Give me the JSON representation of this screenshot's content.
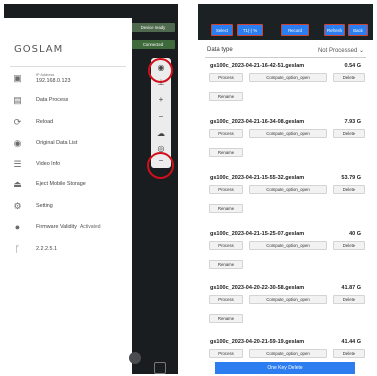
{
  "left_panel": {
    "brand": "GOSLAM",
    "status": {
      "ready": "Device ready",
      "connected": "Connected"
    },
    "menu": [
      {
        "icon": "device-icon",
        "sublabel": "IP Address",
        "value": "192.168.0.123"
      },
      {
        "icon": "clipboard-icon",
        "label": "Data Process"
      },
      {
        "icon": "reload-icon",
        "label": "Reload"
      },
      {
        "icon": "circle-icon",
        "label": "Original Data List"
      },
      {
        "icon": "list-icon",
        "label": "Video Info"
      },
      {
        "icon": "eject-icon",
        "label": "Eject Mobile Storage"
      },
      {
        "icon": "gear-icon",
        "label": "Setting"
      },
      {
        "icon": "info-icon",
        "label": "Firmware Validity",
        "suffix": "Activated"
      },
      {
        "icon": "branch-icon",
        "label": "2.2.2.5.1"
      }
    ],
    "toolbar_icons": [
      "eye-icon",
      "antenna-icon",
      "plus-icon",
      "minus-icon",
      "cloud-icon",
      "compass-icon",
      "minus-icon"
    ]
  },
  "right_panel": {
    "toolbar": {
      "select": "Select",
      "filter": "T1(-) %",
      "record": "Record",
      "refresh": "Refresh",
      "back": "Back"
    },
    "data_type_label": "Data type",
    "filter_value": "Not Processed",
    "files": [
      {
        "name": "gs100c_2023-04-21-16-42-51.geslam",
        "size": "0.54 G"
      },
      {
        "name": "gs100c_2023-04-21-16-34-08.geslam",
        "size": "7.93 G"
      },
      {
        "name": "gs100c_2023-04-21-15-55-32.geslam",
        "size": "53.79 G"
      },
      {
        "name": "gs100c_2023-04-21-15-25-07.geslam",
        "size": "40 G"
      },
      {
        "name": "gs100c_2023-04-20-22-30-58.geslam",
        "size": "41.87 G"
      },
      {
        "name": "gs100c_2023-04-20-21-59-19.geslam",
        "size": "41.44 G"
      }
    ],
    "buttons": {
      "process": "Process",
      "compute": "Compute_option_open",
      "delete": "Delete",
      "rename": "Rename"
    },
    "one_key_delete": "One Key Delete"
  },
  "colors": {
    "accent": "#2c7ef0",
    "annotation": "#d0101a",
    "dark": "#1a1d1f"
  }
}
